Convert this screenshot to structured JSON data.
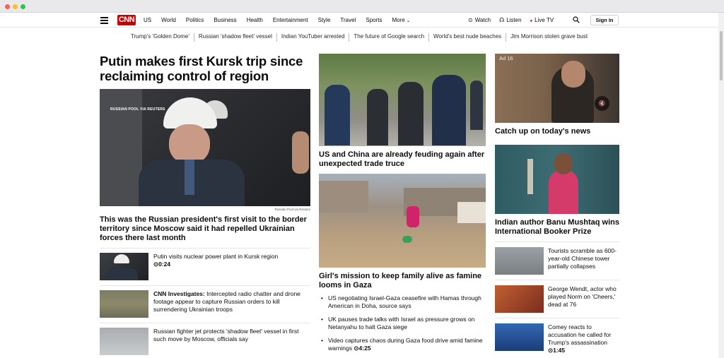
{
  "header": {
    "logo": "CNN",
    "nav": [
      "US",
      "World",
      "Politics",
      "Business",
      "Health",
      "Entertainment",
      "Style",
      "Travel",
      "Sports",
      "More"
    ],
    "watch": "Watch",
    "listen": "Listen",
    "live_tv": "Live TV",
    "sign_in": "Sign In"
  },
  "trending": [
    "Trump's 'Golden Dome'",
    "Russian 'shadow fleet' vessel",
    "Indian YouTuber arrested",
    "The future of Google search",
    "World's best nude beaches",
    "Jim Morrison stolen grave bust"
  ],
  "lead": {
    "title": "Putin makes first Kursk trip since reclaiming control of region",
    "image_tag": "RUSSIAN POOL VIA REUTERS",
    "image_credit": "Russian Pool via Reuters",
    "summary": "This was the Russian president's first visit to the border territory since Moscow said it had repelled Ukrainian forces there last month"
  },
  "left_list": [
    {
      "text": "Putin visits nuclear power plant in Kursk region",
      "duration": "0:24"
    },
    {
      "prefix": "CNN Investigates:",
      "text": " Intercepted radio chatter and drone footage appear to capture Russian orders to kill surrendering Ukrainian troops"
    },
    {
      "text": "Russian fighter jet protects 'shadow fleet' vessel in first such move by Moscow, officials say"
    }
  ],
  "middle": {
    "story1": "US and China are already feuding again after unexpected trade truce",
    "story2": "Girl's mission to keep family alive as famine looms in Gaza",
    "bullets": [
      {
        "text": "US negotiating Israel-Gaza ceasefire with Hamas through American in Doha, source says"
      },
      {
        "text": "UK pauses trade talks with Israel as pressure grows on Netanyahu to halt Gaza siege"
      },
      {
        "text": "Video captures chaos during Gaza food drive amid famine warnings",
        "duration": "4:25"
      }
    ]
  },
  "right": {
    "ad_label": "Ad 16",
    "ad_caption": "Catch up on today's news",
    "story": "Indian author Banu Mushtaq wins International Booker Prize",
    "list": [
      {
        "text": "Tourists scramble as 600-year-old Chinese tower partially collapses"
      },
      {
        "text": "George Wendt, actor who played Norm on 'Cheers,' dead at 76"
      },
      {
        "text": "Comey reacts to accusation he called for Trump's assassination",
        "duration": "1:45"
      }
    ]
  },
  "colors": {
    "brand": "#cc0000",
    "text": "#0c0c0c",
    "divider": "#e6e6e6"
  }
}
